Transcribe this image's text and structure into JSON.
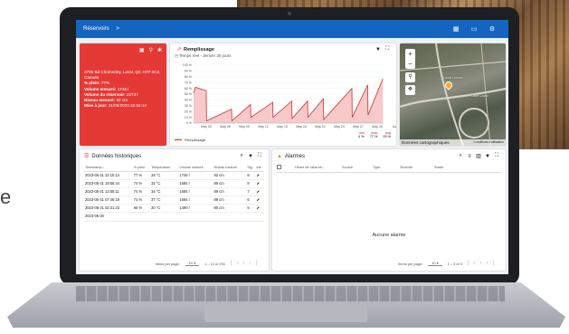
{
  "side_text": "e",
  "appbar": {
    "breadcrumb": "Réservoirs",
    "chevron": ">",
    "actions": [
      {
        "icon": "dashboard-icon",
        "glyph": "▦"
      },
      {
        "icon": "map-icon",
        "glyph": "▭"
      },
      {
        "icon": "settings-icon",
        "glyph": "⚙"
      }
    ]
  },
  "info_card": {
    "icons": [
      "save-icon",
      "pin-icon",
      "gear-icon"
    ],
    "address": "2795 Bd Chomedey, Laval, QC H7P 0C2, Canada",
    "rows": [
      {
        "label": "% plein:",
        "value": "77%"
      },
      {
        "label": "Volume mesuré:",
        "value": "1746 l"
      },
      {
        "label": "Volume du réservoir:",
        "value": "2273 l"
      },
      {
        "label": "Niveau mesuré:",
        "value": "92 cm"
      },
      {
        "label": "Mise à jour:",
        "value": "31/05/2023 22:15:14"
      }
    ]
  },
  "chart_card": {
    "title": "Remplissage",
    "subtitle": "Temps réel - dernier 30 jours",
    "legend": "Remplissage",
    "stats": [
      {
        "label": "min",
        "value": "4 %"
      },
      {
        "label": "max",
        "value": "77 %"
      },
      {
        "label": "avg",
        "value": "29 %"
      }
    ]
  },
  "chart_data": {
    "type": "area",
    "y_tick_labels": [
      "100 %",
      "90 %",
      "80 %",
      "70 %",
      "60 %",
      "50 %",
      "40 %",
      "30 %",
      "20 %",
      "10 %",
      "0 %"
    ],
    "x_tick_labels": [
      "May 03",
      "May 06",
      "May 09",
      "May 12",
      "May 15",
      "May 18",
      "May 21",
      "May 24",
      "May 27",
      "May 30",
      "Jun 0"
    ],
    "ylim": [
      0,
      100
    ],
    "series": [
      {
        "name": "Remplissage",
        "x": [
          0,
          0.3,
          2,
          2.05,
          6,
          6.05,
          9,
          9.05,
          12.5,
          12.55,
          15.5,
          15.55,
          18,
          18.05,
          20.5,
          20.55,
          25,
          25.05,
          27.5,
          27.55,
          29.9
        ],
        "y": [
          52,
          62,
          56,
          4,
          24,
          4,
          32,
          10,
          36,
          10,
          38,
          8,
          38,
          10,
          42,
          6,
          60,
          10,
          66,
          14,
          77
        ]
      }
    ],
    "color": "#d32f2f",
    "fill": "#f8c9c9"
  },
  "map_card": {
    "labels": [
      "Laval Lincoln",
      "Carré Laval"
    ],
    "attribution": "Données cartographiques",
    "attribution_small": "Conditions d'utilisation",
    "zoom_in": "+",
    "zoom_out": "−"
  },
  "history": {
    "title": "Données historiques",
    "columns": [
      "Timestamp ↓",
      "% plein",
      "Température",
      "Volume mesuré",
      "Niveau mesuré",
      "Sig",
      "Ins"
    ],
    "rows": [
      [
        "2023-05-31 22:15:14",
        "77 %",
        "28 °C",
        "1746 l",
        "92 cm",
        "8",
        "⬈"
      ],
      [
        "2023-05-31 19:56:44",
        "74 %",
        "32 °C",
        "1684 l",
        "89 cm",
        "8",
        "⬈"
      ],
      [
        "2023-05-31 13:55:11",
        "74 %",
        "34 °C",
        "1684 l",
        "89 cm",
        "7",
        "⬈"
      ],
      [
        "2023-05-31 07:46:19",
        "74 %",
        "37 °C",
        "1684 l",
        "89 cm",
        "6",
        "⬈"
      ],
      [
        "2023-05-31 02:31:23",
        "66 %",
        "20 °C",
        "1490 l",
        "80 cm",
        "5",
        "⬈"
      ],
      [
        "2023-05-30",
        "",
        "",
        "",
        "",
        "",
        ""
      ]
    ],
    "pager": {
      "label": "Items per page:",
      "size": "10",
      "range": "1 – 10 of 290"
    }
  },
  "alarms": {
    "title": "Alarmes",
    "columns": [
      "Heure de l'alarme ↓",
      "Source",
      "Type",
      "Sévérité",
      "Statut"
    ],
    "empty": "Aucune alarme",
    "pager": {
      "label": "Items per page:",
      "size": "10",
      "range": "1 – 0 of 0"
    }
  }
}
